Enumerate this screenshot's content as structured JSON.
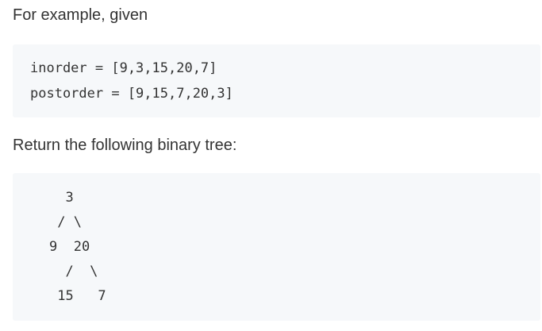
{
  "paragraphs": {
    "intro": "For example, given",
    "result": "Return the following binary tree:"
  },
  "input_block": {
    "lines": [
      "inorder = [9,3,15,20,7]",
      "postorder = [9,15,7,20,3]"
    ]
  },
  "tree_block": {
    "lines": [
      "  3",
      " / \\",
      "9  20",
      "  /  \\",
      " 15   7"
    ]
  }
}
